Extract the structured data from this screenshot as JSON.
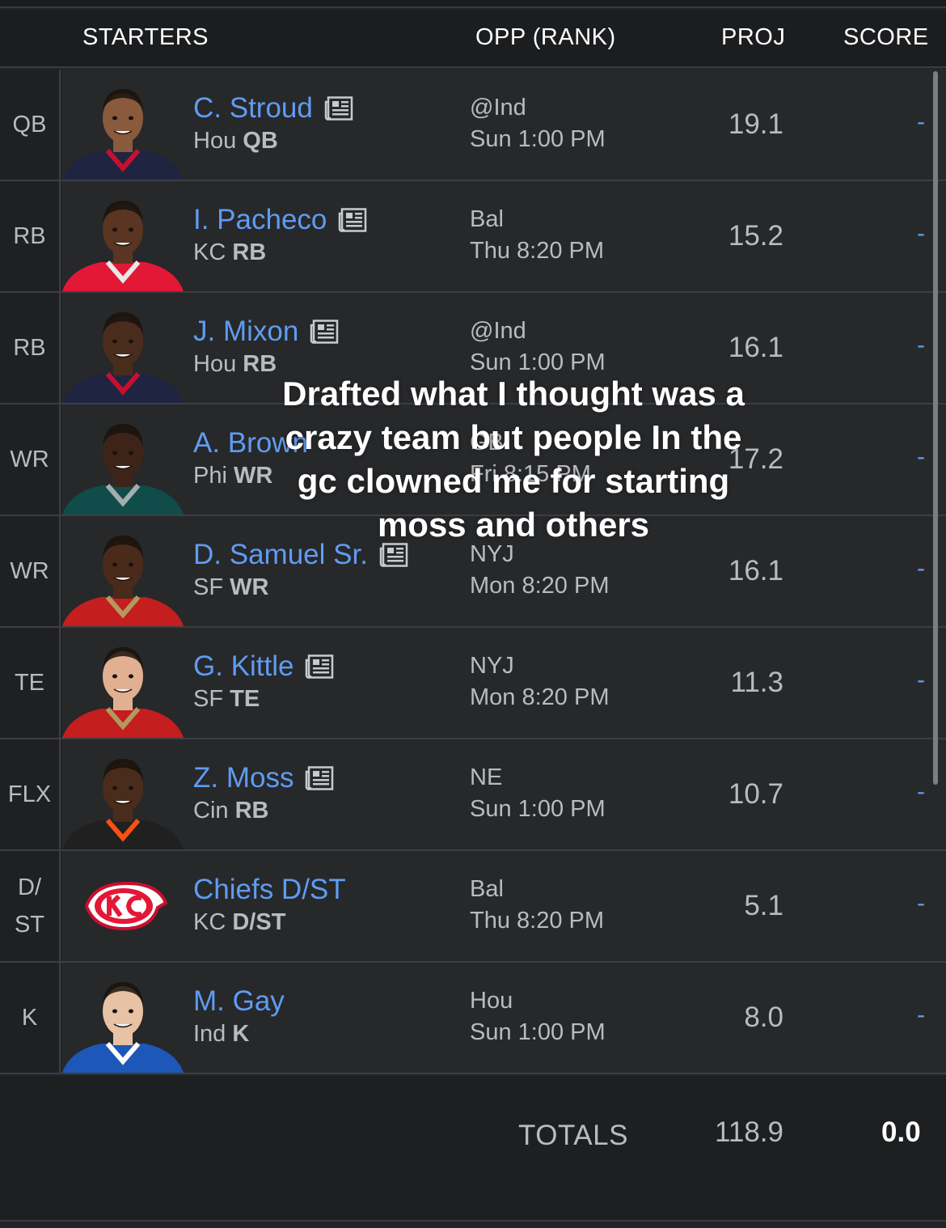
{
  "header": {
    "starters": "STARTERS",
    "opp": "OPP (RANK)",
    "proj": "PROJ",
    "score": "SCORE"
  },
  "rows": [
    {
      "slot": "QB",
      "name": "C. Stroud",
      "team": "Hou",
      "pos": "QB",
      "opp": "@Ind",
      "time": "Sun 1:00 PM",
      "proj": "19.1",
      "score": "-",
      "news": true,
      "skin": "#8a5a3c",
      "jersey": "#1f2540",
      "trim": "#c8102e"
    },
    {
      "slot": "RB",
      "name": "I. Pacheco",
      "team": "KC",
      "pos": "RB",
      "opp": "Bal",
      "time": "Thu 8:20 PM",
      "proj": "15.2",
      "score": "-",
      "news": true,
      "skin": "#5a3522",
      "jersey": "#e31837",
      "trim": "#e8e8e8"
    },
    {
      "slot": "RB",
      "name": "J. Mixon",
      "team": "Hou",
      "pos": "RB",
      "opp": "@Ind",
      "time": "Sun 1:00 PM",
      "proj": "16.1",
      "score": "-",
      "news": true,
      "skin": "#4a2c1c",
      "jersey": "#1f2540",
      "trim": "#c8102e"
    },
    {
      "slot": "WR",
      "name": "A. Brown",
      "team": "Phi",
      "pos": "WR",
      "opp": "GB",
      "time": "Fri 8:15 PM",
      "proj": "17.2",
      "score": "-",
      "news": false,
      "skin": "#3e2418",
      "jersey": "#0f4c4a",
      "trim": "#a5acaf"
    },
    {
      "slot": "WR",
      "name": "D. Samuel Sr.",
      "team": "SF",
      "pos": "WR",
      "opp": "NYJ",
      "time": "Mon 8:20 PM",
      "proj": "16.1",
      "score": "-",
      "news": true,
      "skin": "#4a2a1a",
      "jersey": "#c41e1e",
      "trim": "#b3995d"
    },
    {
      "slot": "TE",
      "name": "G. Kittle",
      "team": "SF",
      "pos": "TE",
      "opp": "NYJ",
      "time": "Mon 8:20 PM",
      "proj": "11.3",
      "score": "-",
      "news": true,
      "skin": "#e0b090",
      "jersey": "#c41e1e",
      "trim": "#b3995d"
    },
    {
      "slot": "FLX",
      "name": "Z. Moss",
      "team": "Cin",
      "pos": "RB",
      "opp": "NE",
      "time": "Sun 1:00 PM",
      "proj": "10.7",
      "score": "-",
      "news": true,
      "skin": "#4a2c1c",
      "jersey": "#202020",
      "trim": "#fb4f14"
    },
    {
      "slot": "D/ ST",
      "name": "Chiefs D/ST",
      "team": "KC",
      "pos": "D/ST",
      "opp": "Bal",
      "time": "Thu 8:20 PM",
      "proj": "5.1",
      "score": "-",
      "news": false,
      "logo": "KC"
    },
    {
      "slot": "K",
      "name": "M. Gay",
      "team": "Ind",
      "pos": "K",
      "opp": "Hou",
      "time": "Sun 1:00 PM",
      "proj": "8.0",
      "score": "-",
      "news": false,
      "skin": "#e8c2a4",
      "jersey": "#1d57b8",
      "trim": "#ffffff"
    }
  ],
  "totals": {
    "label": "TOTALS",
    "proj": "118.9",
    "score": "0.0"
  },
  "overlay_caption": "Drafted what I thought was a crazy team but people In the gc clowned me for starting moss and others"
}
